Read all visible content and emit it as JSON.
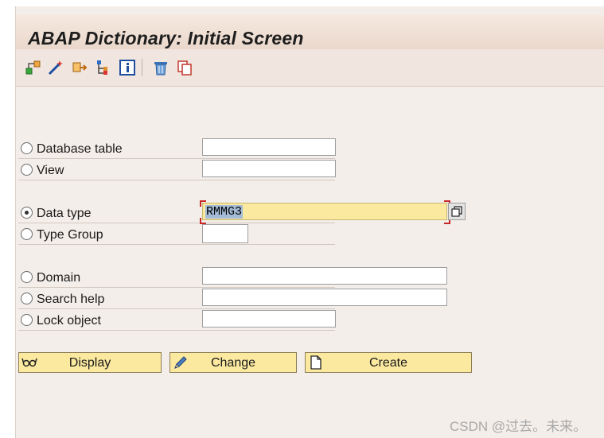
{
  "title": "ABAP Dictionary: Initial Screen",
  "toolbar": {
    "icons": [
      "hierarchy-icon",
      "magic-wand-icon",
      "move-icon",
      "tree-icon",
      "info-icon",
      "delete-icon",
      "copy-icon"
    ]
  },
  "options": {
    "database_table": {
      "label": "Database table",
      "value": "",
      "selected": false
    },
    "view": {
      "label": "View",
      "value": "",
      "selected": false
    },
    "data_type": {
      "label": "Data type",
      "value": "RMMG3",
      "selected": true
    },
    "type_group": {
      "label": "Type Group",
      "value": "",
      "selected": false
    },
    "domain": {
      "label": "Domain",
      "value": "",
      "selected": false
    },
    "search_help": {
      "label": "Search help",
      "value": "",
      "selected": false
    },
    "lock_object": {
      "label": "Lock object",
      "value": "",
      "selected": false
    }
  },
  "buttons": {
    "display": "Display",
    "change": "Change",
    "create": "Create"
  },
  "watermark": "CSDN @过去。未来。",
  "colors": {
    "background": "#f4eeea",
    "title_bar": "#e7d4c7",
    "button_fill": "#fbe9a0",
    "selection": "#a3bbd6",
    "focus_corner": "#c62828"
  }
}
